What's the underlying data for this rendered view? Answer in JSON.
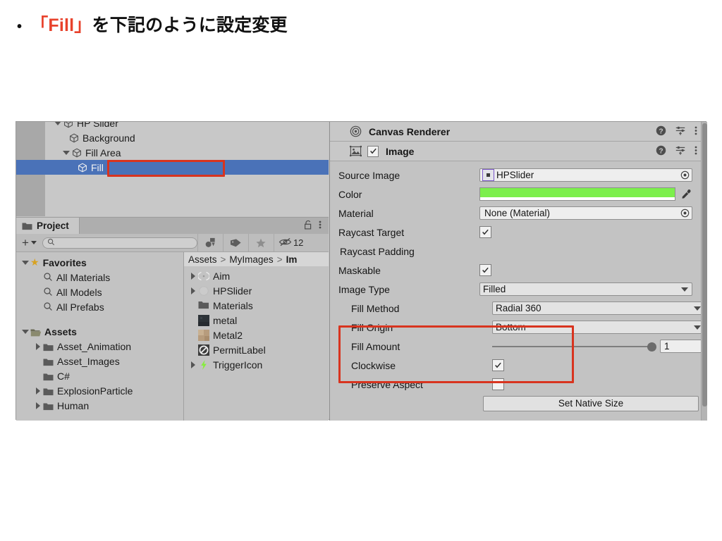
{
  "slide": {
    "bullet": "•",
    "accent_text": "「Fill」",
    "rest_text": "を下記のように設定変更",
    "accent_color": "#e8422c"
  },
  "hierarchy": {
    "rows": [
      {
        "label": "HP Slider",
        "indent": 52,
        "foldout": "down",
        "icon": "cube-icon",
        "selected": false,
        "clipped_top": true
      },
      {
        "label": "Background",
        "indent": 74,
        "foldout": "none",
        "icon": "cube-icon",
        "selected": false
      },
      {
        "label": "Fill Area",
        "indent": 64,
        "foldout": "down",
        "icon": "cube-icon",
        "selected": false
      },
      {
        "label": "Fill",
        "indent": 86,
        "foldout": "none",
        "icon": "cube-icon",
        "selected": true
      }
    ],
    "selection_color": "#4a72b8",
    "annotation_color": "#d8341f"
  },
  "project": {
    "tab_label": "Project",
    "lock_icon": "padlock-open-icon",
    "menu_icon": "kebab-menu-icon",
    "add_label": "+",
    "search_placeholder": "",
    "search_value": "",
    "filter_buttons": [
      {
        "name": "type-filter-icon"
      },
      {
        "name": "label-filter-icon"
      },
      {
        "name": "favorite-filter-icon"
      }
    ],
    "hidden_count": "12",
    "favorites": {
      "label": "Favorites",
      "items": [
        "All Materials",
        "All Models",
        "All Prefabs"
      ]
    },
    "assets_tree": {
      "label": "Assets",
      "items": [
        {
          "label": "Asset_Animation",
          "expandable": true
        },
        {
          "label": "Asset_Images",
          "expandable": false
        },
        {
          "label": "C#",
          "expandable": false
        },
        {
          "label": "ExplosionParticle",
          "expandable": true
        },
        {
          "label": "Human",
          "expandable": true
        }
      ]
    },
    "breadcrumb": [
      "Assets",
      "MyImages",
      "Im"
    ],
    "asset_list": [
      {
        "label": "Aim",
        "expandable": true,
        "icon": "crosshair-thumb"
      },
      {
        "label": "HPSlider",
        "expandable": true,
        "icon": "circle-sprite-thumb"
      },
      {
        "label": "Materials",
        "expandable": false,
        "icon": "folder-icon"
      },
      {
        "label": "metal",
        "expandable": false,
        "icon": "dark-texture-thumb"
      },
      {
        "label": "Metal2",
        "expandable": false,
        "icon": "tan-texture-thumb"
      },
      {
        "label": "PermitLabel",
        "expandable": false,
        "icon": "no-entry-thumb"
      },
      {
        "label": "TriggerIcon",
        "expandable": true,
        "icon": "lightning-bolt-thumb"
      }
    ]
  },
  "inspector": {
    "canvas_renderer": {
      "title": "Canvas Renderer",
      "foldout": "collapsed",
      "icon": "canvas-renderer-icon",
      "help_icon": "help-icon",
      "preset_icon": "preset-icon",
      "menu_icon": "kebab-menu-icon"
    },
    "image": {
      "title": "Image",
      "foldout": "expanded",
      "icon": "image-component-icon",
      "enabled": true,
      "help_icon": "help-icon",
      "preset_icon": "preset-icon",
      "menu_icon": "kebab-menu-icon",
      "properties": {
        "source_image": {
          "label": "Source Image",
          "value": "HPSlider"
        },
        "color": {
          "label": "Color",
          "value": "#7CEF4C"
        },
        "material": {
          "label": "Material",
          "value": "None (Material)"
        },
        "raycast_target": {
          "label": "Raycast Target",
          "checked": true
        },
        "raycast_padding": {
          "label": "Raycast Padding",
          "foldout": "collapsed"
        },
        "maskable": {
          "label": "Maskable",
          "checked": true
        },
        "image_type": {
          "label": "Image Type",
          "value": "Filled"
        },
        "fill_method": {
          "label": "Fill Method",
          "value": "Radial 360"
        },
        "fill_origin": {
          "label": "Fill Origin",
          "value": "Bottom"
        },
        "fill_amount": {
          "label": "Fill Amount",
          "value": "1",
          "slider_position": 1.0
        },
        "clockwise": {
          "label": "Clockwise",
          "checked": true
        },
        "preserve_aspect": {
          "label": "Preserve Aspect",
          "checked": false
        },
        "set_native_size": {
          "label": "Set Native Size"
        }
      },
      "annotation_color": "#d8341f"
    }
  }
}
